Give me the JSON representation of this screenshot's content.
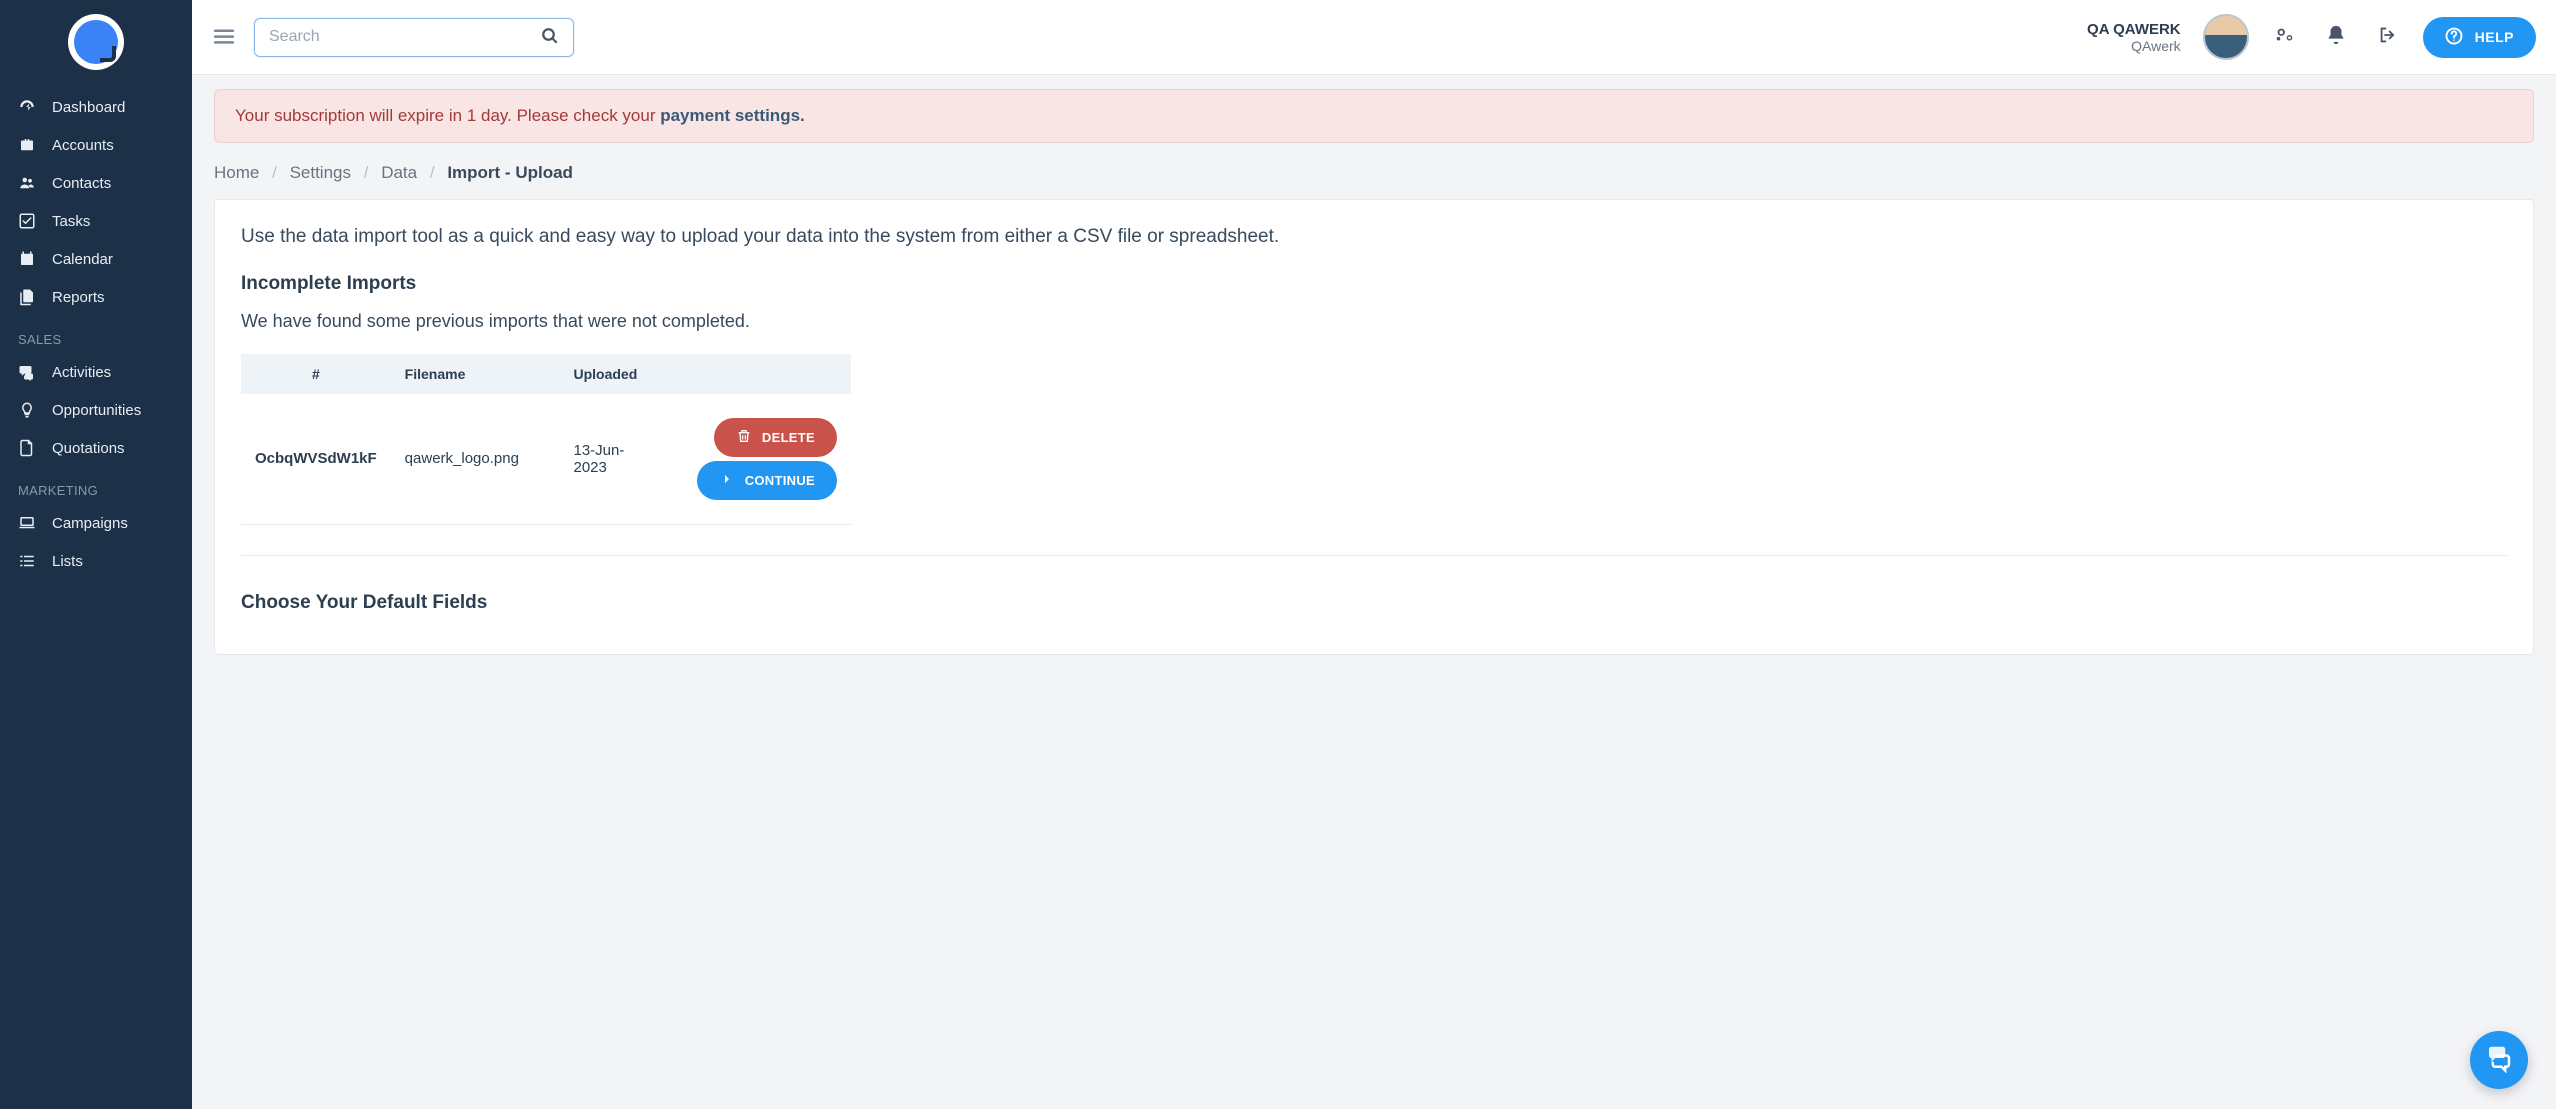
{
  "header": {
    "search_placeholder": "Search",
    "user_name": "QA QAWERK",
    "user_org": "QAwerk",
    "help_label": "HELP"
  },
  "sidebar": {
    "main": [
      {
        "label": "Dashboard",
        "icon": "dashboard"
      },
      {
        "label": "Accounts",
        "icon": "briefcase"
      },
      {
        "label": "Contacts",
        "icon": "users"
      },
      {
        "label": "Tasks",
        "icon": "check-square"
      },
      {
        "label": "Calendar",
        "icon": "calendar"
      },
      {
        "label": "Reports",
        "icon": "file-copy"
      }
    ],
    "section_sales": "SALES",
    "sales": [
      {
        "label": "Activities",
        "icon": "comments"
      },
      {
        "label": "Opportunities",
        "icon": "lightbulb"
      },
      {
        "label": "Quotations",
        "icon": "file"
      }
    ],
    "section_marketing": "MARKETING",
    "marketing": [
      {
        "label": "Campaigns",
        "icon": "laptop"
      },
      {
        "label": "Lists",
        "icon": "list"
      }
    ]
  },
  "alert": {
    "text_before": "Your subscription will expire in 1 day. Please check your ",
    "link_text": "payment settings.",
    "text_after": ""
  },
  "breadcrumb": {
    "items": [
      "Home",
      "Settings",
      "Data"
    ],
    "current": "Import - Upload"
  },
  "import": {
    "intro": "Use the data import tool as a quick and easy way to upload your data into the system from either a CSV file or spreadsheet.",
    "incomplete_heading": "Incomplete Imports",
    "incomplete_body": "We have found some previous imports that were not completed.",
    "table": {
      "headers": [
        "#",
        "Filename",
        "Uploaded",
        ""
      ],
      "rows": [
        {
          "id": "OcbqWVSdW1kF",
          "filename": "qawerk_logo.png",
          "uploaded": "13-Jun-2023"
        }
      ]
    },
    "delete_label": "DELETE",
    "continue_label": "CONTINUE",
    "choose_heading": "Choose Your Default Fields"
  }
}
